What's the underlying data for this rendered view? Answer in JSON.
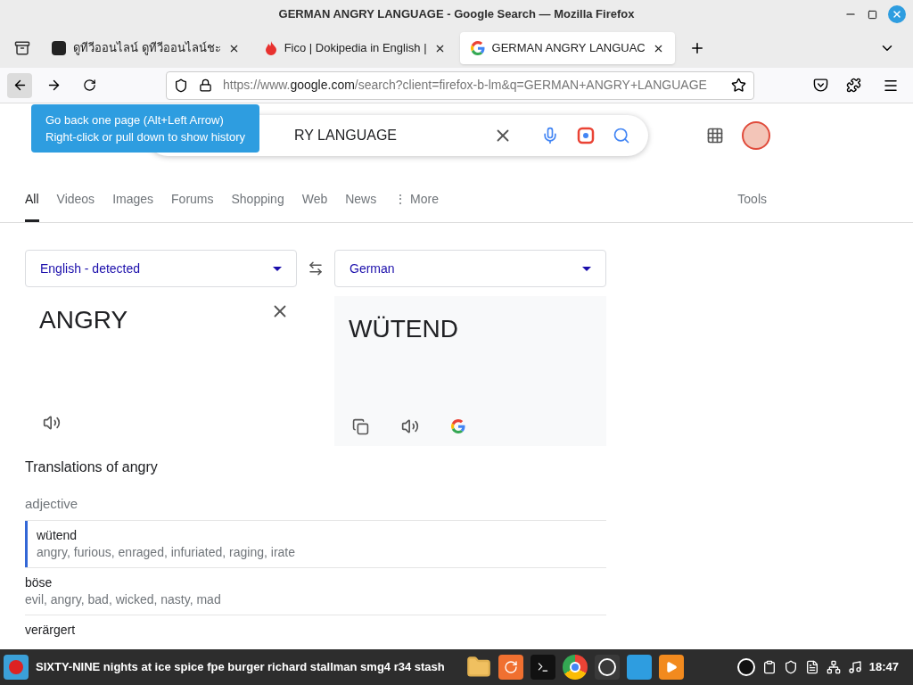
{
  "window": {
    "title": "GERMAN ANGRY LANGUAGE - Google Search — Mozilla Firefox"
  },
  "tabs": [
    {
      "label": "ดูทีวีออนไลน์ ดูทีวีออนไลน์ชะ",
      "selected": false,
      "kind": "number"
    },
    {
      "label": "Fico | Dokipedia in English |",
      "selected": false,
      "kind": "flame"
    },
    {
      "label": "GERMAN ANGRY LANGUAC",
      "selected": true,
      "kind": "google"
    }
  ],
  "address": {
    "host": "https://www.google.com",
    "path": "/search?client=firefox-b-lm&q=GERMAN+ANGRY+LANGUAGE"
  },
  "tooltip": {
    "lines": [
      "Go back one page (Alt+Left Arrow)",
      "Right-click or pull down to show history"
    ]
  },
  "search": {
    "value": "RY LANGUAGE"
  },
  "search_tabs": [
    {
      "label": "All",
      "selected": true
    },
    {
      "label": "Videos",
      "selected": false
    },
    {
      "label": "Images",
      "selected": false
    },
    {
      "label": "Forums",
      "selected": false
    },
    {
      "label": "Shopping",
      "selected": false
    },
    {
      "label": "Web",
      "selected": false
    },
    {
      "label": "News",
      "selected": false
    },
    {
      "label": "⋮ More",
      "selected": false
    }
  ],
  "tools": "Tools",
  "translator": {
    "source_lang": "English - detected",
    "target_lang": "German",
    "source_text": "ANGRY",
    "target_text": "WÜTEND"
  },
  "translations": {
    "title": "Translations of angry",
    "part_of_speech": "adjective",
    "rows": [
      {
        "word": "wütend",
        "meanings": "angry, furious, enraged, infuriated, raging, irate",
        "selected": true
      },
      {
        "word": "böse",
        "meanings": "evil, angry, bad, wicked, nasty, mad",
        "selected": false
      },
      {
        "word": "verärgert",
        "selected": false
      }
    ]
  },
  "taskbar": {
    "window_title": "SIXTY-NINE nights at ice spice fpe burger richard stallman smg4 r34 stash",
    "clock": "18:47"
  }
}
